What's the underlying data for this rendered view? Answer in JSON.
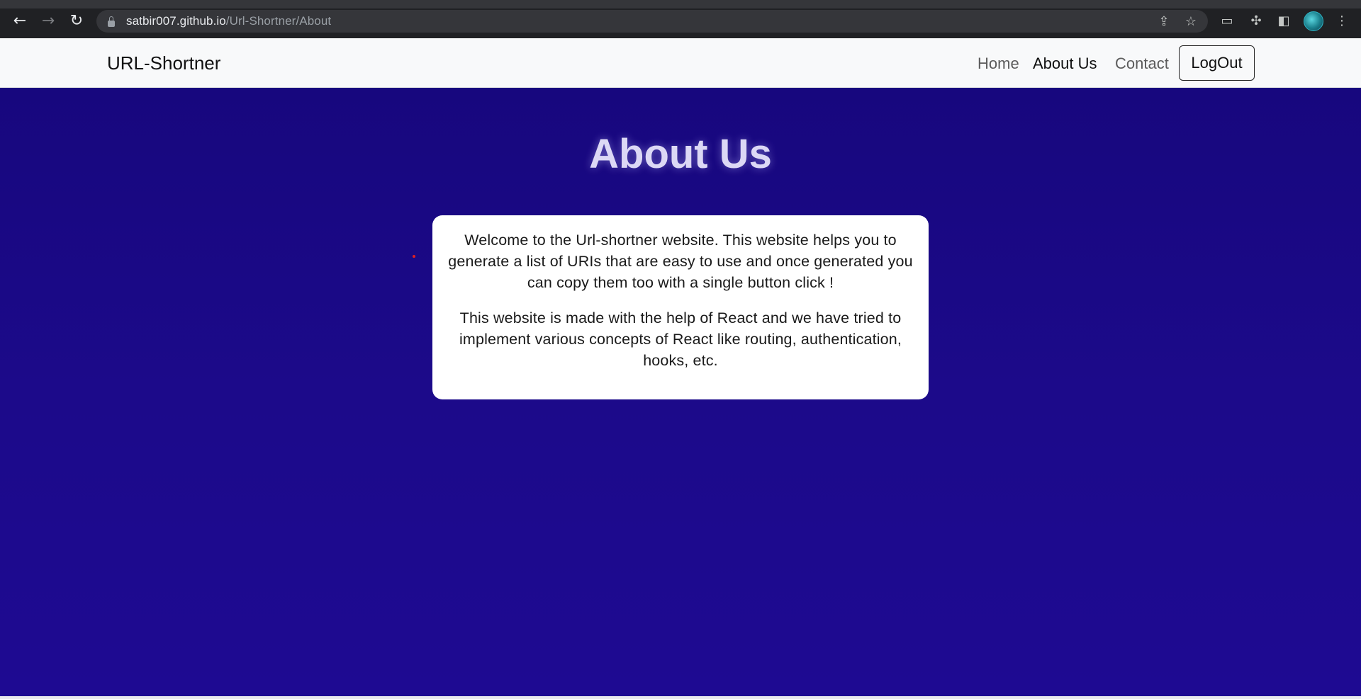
{
  "browser": {
    "url_host": "satbir007.github.io",
    "url_path": "/Url-Shortner/About",
    "icons": {
      "back": "back-arrow-icon",
      "forward": "forward-arrow-icon",
      "reload": "reload-icon",
      "share": "share-icon",
      "bookmark": "star-icon",
      "cast": "cast-icon",
      "extensions": "puzzle-icon",
      "sidepanel": "side-panel-icon",
      "profile": "avatar",
      "menu": "kebab-menu-icon"
    }
  },
  "navbar": {
    "brand": "URL-Shortner",
    "links": [
      {
        "label": "Home",
        "active": false
      },
      {
        "label": "About Us",
        "active": true
      },
      {
        "label": "Contact",
        "active": false
      }
    ],
    "logout_label": "LogOut"
  },
  "main": {
    "title": "About Us",
    "paragraphs": [
      "Welcome to the Url-shortner website. This website helps you to generate a list of URIs that are easy to use and once generated you can copy them too with a single button click !",
      "This website is made with the help of React and we have tried to implement various concepts of React like routing, authentication, hooks, etc."
    ]
  },
  "colors": {
    "background": "#1a0a8a",
    "navbar": "#f8f9fa",
    "card": "#ffffff",
    "title": "#dcd8f5"
  }
}
